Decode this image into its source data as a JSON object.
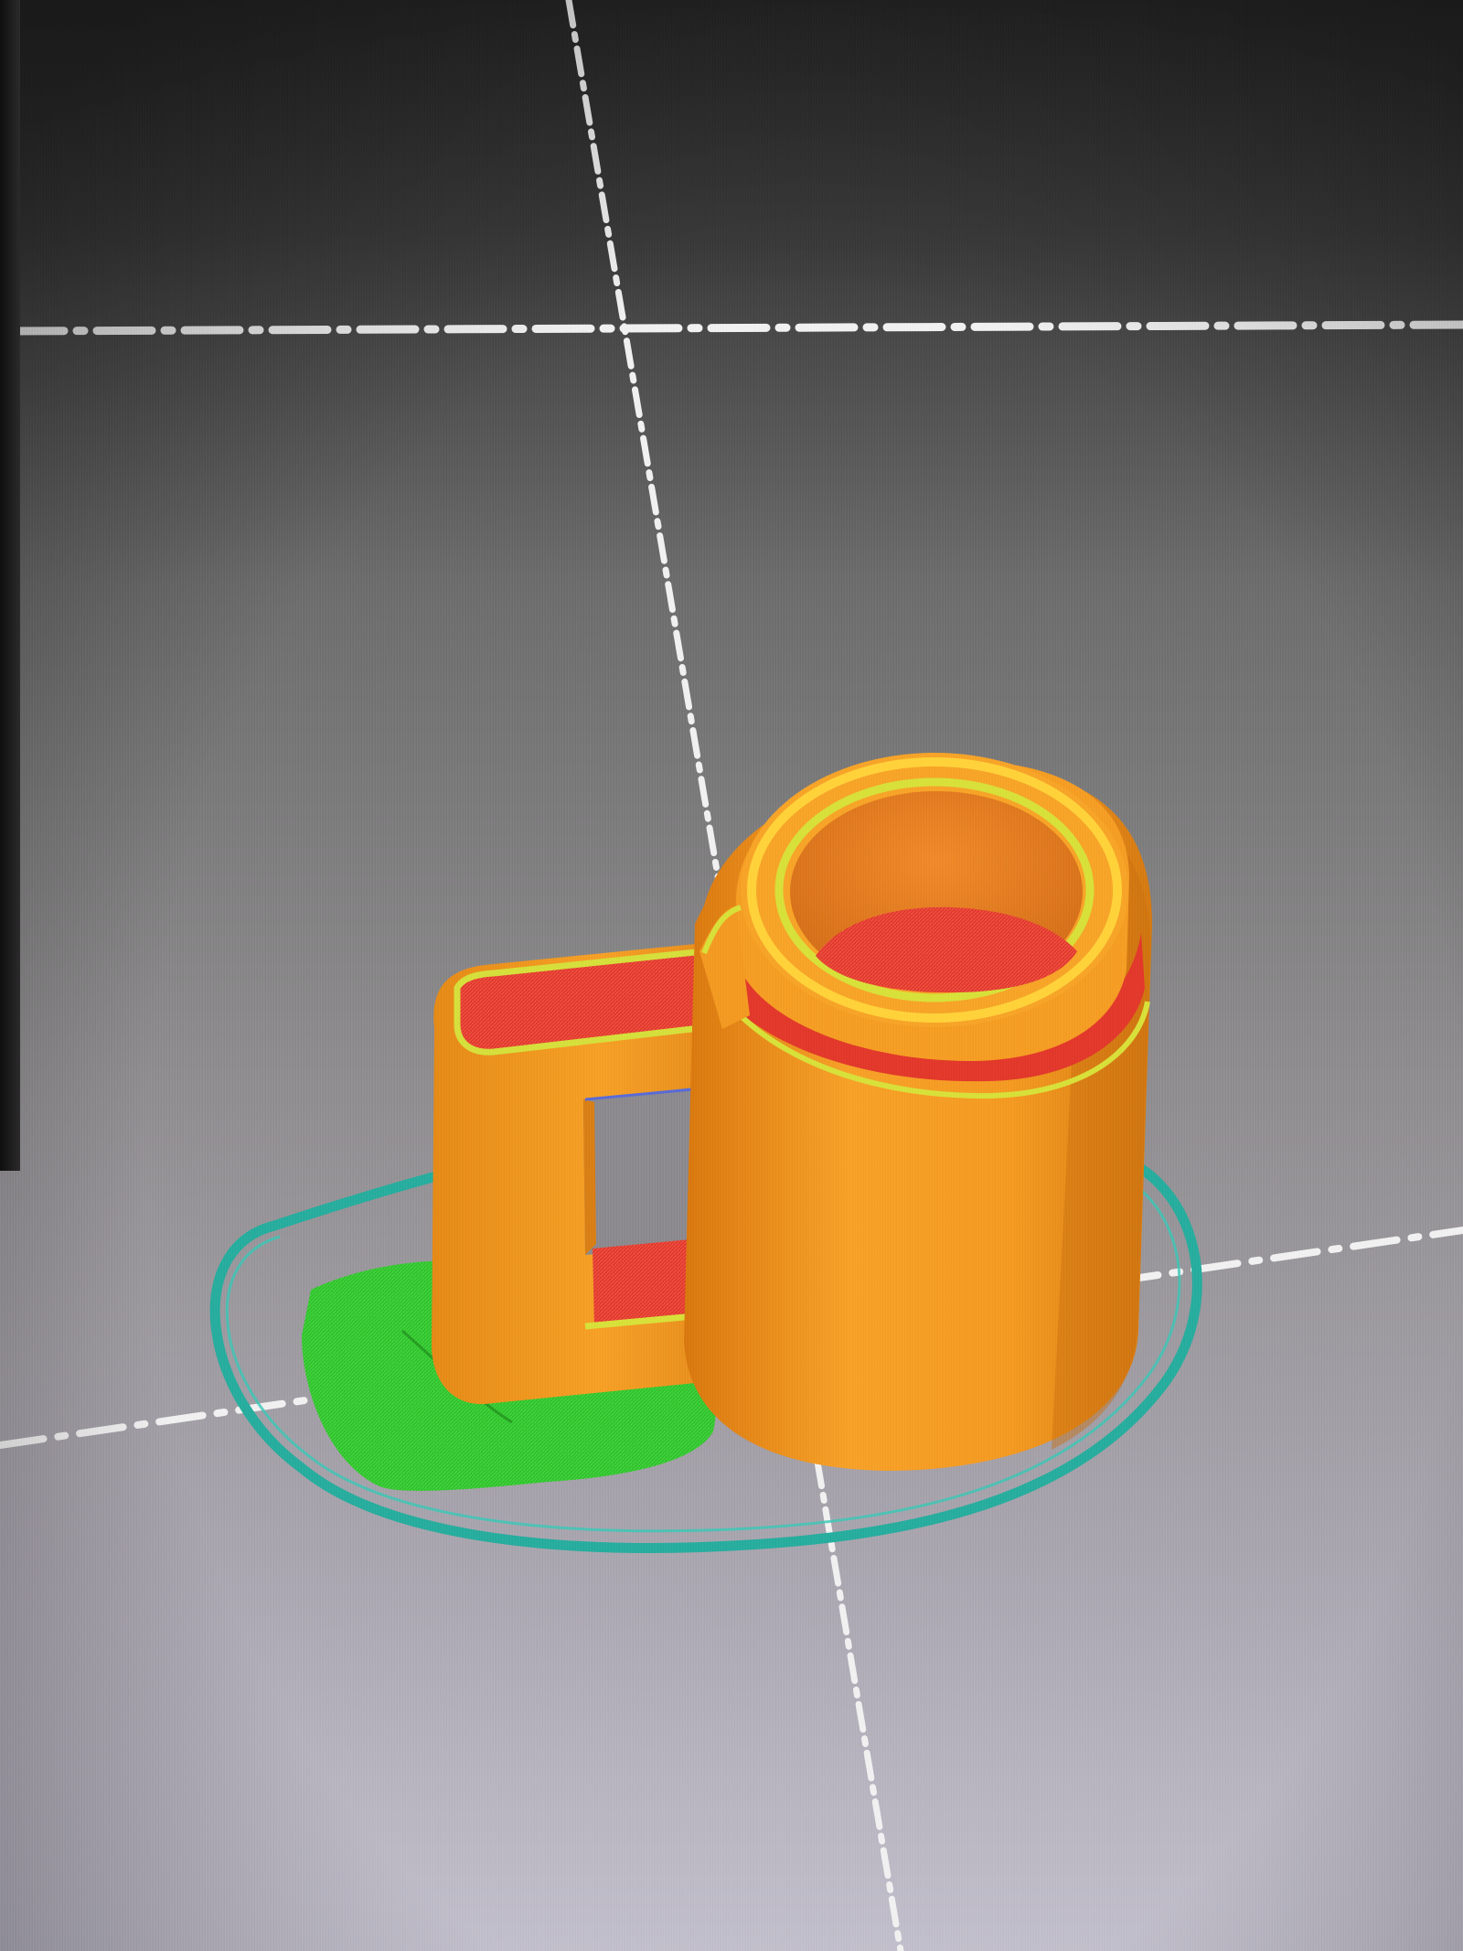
{
  "viewport": {
    "view": "3d-slice-preview",
    "colors": {
      "background_top": "#2b2b2b",
      "background_mid": "#7a7a7a",
      "background_bottom": "#b3b0bd",
      "bed_grid_line": "#f2f2f2",
      "wall_orange": "#f0951e",
      "wall_highlight": "#ffb12e",
      "top_surface_red": "#e53a2c",
      "outline_yellow": "#d8e03a",
      "support_green": "#2ec42a",
      "skirt_teal": "#2bb3a3",
      "bridge_blue": "#5a6bd6"
    },
    "legend": {
      "outer_wall": "wall-orange",
      "top_solid_infill": "red",
      "inner_perimeter": "yellow",
      "support_material": "green",
      "skirt": "teal"
    }
  },
  "model": {
    "object": "mug"
  }
}
